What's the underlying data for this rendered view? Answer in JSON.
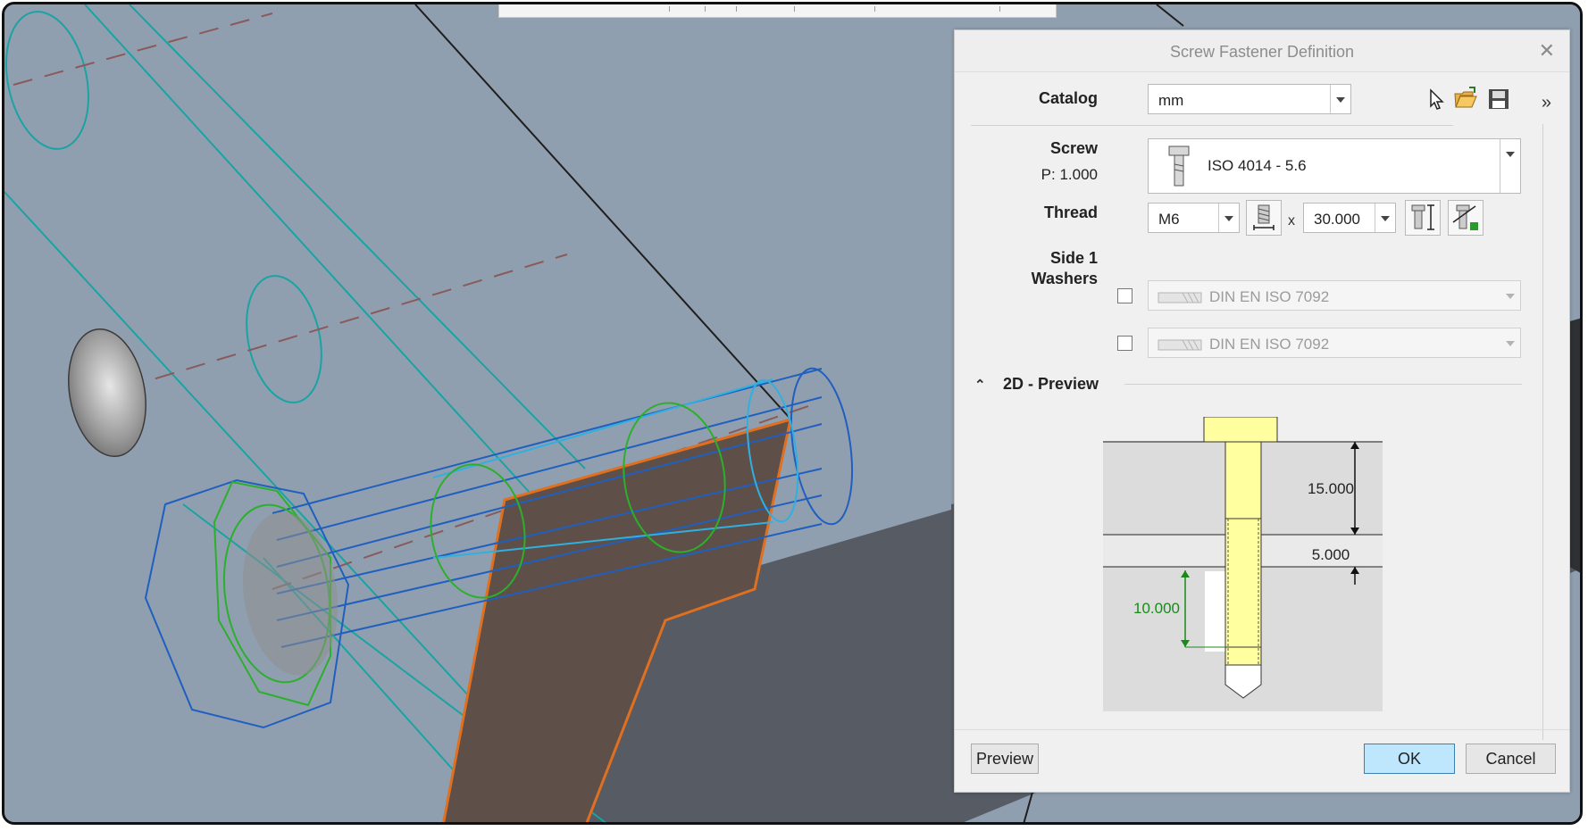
{
  "dialog": {
    "title": "Screw Fastener Definition",
    "close_icon": "close-x",
    "expand_icon": "double-chevron-right",
    "catalog": {
      "label": "Catalog",
      "value": "mm"
    },
    "screw": {
      "label": "Screw",
      "pitch": "P: 1.000",
      "value": "ISO 4014 - 5.6",
      "icon": "bolt-icon"
    },
    "thread": {
      "label": "Thread",
      "size": "M6",
      "times": "x",
      "length": "30.000"
    },
    "washers": {
      "label_line1": "Side 1",
      "label_line2": "Washers",
      "washer1": "DIN EN ISO 7092",
      "washer2": "DIN EN ISO 7092",
      "washer1_checked": false,
      "washer2_checked": false
    },
    "preview_section": {
      "label": "2D - Preview",
      "dim_top": "15.000",
      "dim_mid": "5.000",
      "dim_engage": "10.000"
    },
    "buttons": {
      "preview": "Preview",
      "ok": "OK",
      "cancel": "Cancel"
    },
    "colors": {
      "accent_ok": "#bee6fd",
      "bolt_fill": "#ffffa0",
      "engage_green": "#1a8a1a"
    }
  }
}
